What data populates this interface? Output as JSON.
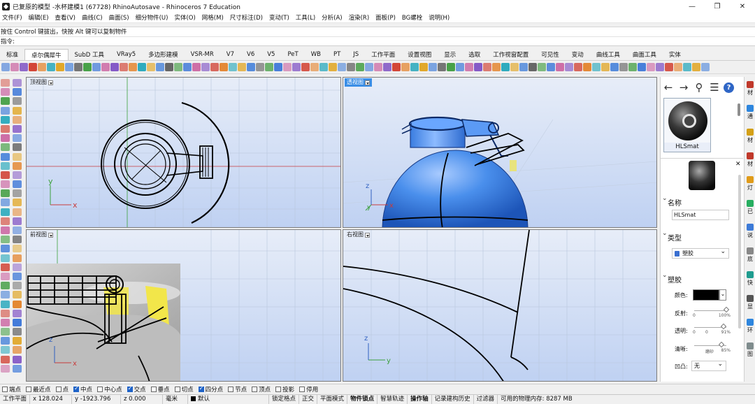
{
  "window": {
    "title": "已复原的模型 -水杯建模1 (67728) RhinoAutosave - Rhinoceros 7 Education",
    "controls": [
      "—",
      "❐",
      "✕"
    ]
  },
  "menu": [
    "文件(F)",
    "编辑(E)",
    "查看(V)",
    "曲线(C)",
    "曲面(S)",
    "细分物件(U)",
    "实体(O)",
    "网格(M)",
    "尺寸标注(D)",
    "变动(T)",
    "工具(L)",
    "分析(A)",
    "渲染(R)",
    "面板(P)",
    "BG螺栓",
    "说明(H)"
  ],
  "command": {
    "history": "按住 Control 键拔出，快按 Alt 键可以复制物件",
    "prompt": "指令:",
    "input_value": ""
  },
  "tabs": [
    "标准",
    "卓尔偶犀牛",
    "SubD 工具",
    "VRay5",
    "多边形建模",
    "VSR-MR",
    "V7",
    "V6",
    "V5",
    "PeT",
    "WB",
    "PT",
    "JS",
    "工作平面",
    "设置视图",
    "显示",
    "选取",
    "工作视窗配置",
    "可见性",
    "变动",
    "曲线工具",
    "曲面工具",
    "实体"
  ],
  "active_tab": "卓尔偶犀牛",
  "viewports": {
    "top": {
      "title": "顶视图"
    },
    "perspective": {
      "title": "透视图"
    },
    "front": {
      "title": "前视图"
    },
    "right": {
      "title": "右视图"
    }
  },
  "axes": {
    "x": "x",
    "y": "y",
    "z": "z"
  },
  "material_panel": {
    "nav": {
      "back": "←",
      "forward": "→",
      "search": "⚲",
      "menu": "☰",
      "help": "?"
    },
    "thumbnail_label": "HLSmat",
    "close": "✕",
    "name_section": "名称",
    "name_value": "HLSmat",
    "type_section": "类型",
    "type_value": "塑胶",
    "plastic_section": "塑胶",
    "color_label": "颜色:",
    "color_value": "#000000",
    "color_dd": "⌄",
    "reflect_label": "反射:",
    "reflect": {
      "min": "0",
      "value": "",
      "max": "100%",
      "fraction": 1.0
    },
    "transp_label": "透明:",
    "transp": {
      "min": "0",
      "value": "0",
      "max": "91%",
      "fraction": 0.91
    },
    "clarity_label": "清晰:",
    "clarity": {
      "min": "",
      "value": "磨砂",
      "max": "85%",
      "fraction": 0.85
    },
    "bump_label": "凹凸:",
    "bump_value": "无"
  },
  "right_tabs": [
    "材",
    "通",
    "材",
    "材",
    "灯",
    "已",
    "说",
    "底",
    "快",
    "显",
    "环",
    "图"
  ],
  "osnaps": [
    {
      "label": "端点",
      "on": false
    },
    {
      "label": "最近点",
      "on": false
    },
    {
      "label": "点",
      "on": false
    },
    {
      "label": "中点",
      "on": true
    },
    {
      "label": "中心点",
      "on": false
    },
    {
      "label": "交点",
      "on": true
    },
    {
      "label": "垂点",
      "on": false
    },
    {
      "label": "切点",
      "on": false
    },
    {
      "label": "四分点",
      "on": true
    },
    {
      "label": "节点",
      "on": false
    },
    {
      "label": "顶点",
      "on": false
    },
    {
      "label": "投影",
      "on": false
    },
    {
      "label": "停用",
      "on": false
    }
  ],
  "status": {
    "cplane": "工作平面",
    "x": "x 128.024",
    "y": "y -1923.796",
    "z": "z 0.000",
    "units": "毫米",
    "layer": "默认",
    "lock": "锁定格点",
    "ortho": "正交",
    "planar": "平面模式",
    "osnap": "物件锁点",
    "smarttrack": "智慧轨迹",
    "gumball": "操作轴",
    "history": "记录建构历史",
    "filter": "过滤器",
    "memory": "可用的物理内存: 8287 MB"
  },
  "colors": {
    "accent": "#3a8ee6",
    "model_blue": "#4a8fec",
    "yellow_part": "#f2e64a",
    "grid": "#b8c6dc",
    "x_axis": "#c83c3c",
    "y_axis": "#3ca03c"
  }
}
